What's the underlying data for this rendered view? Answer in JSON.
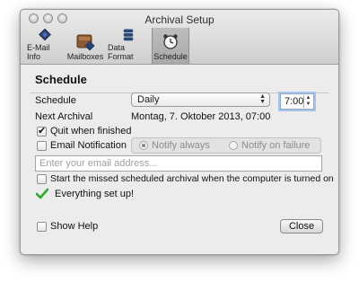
{
  "window": {
    "title": "Archival Setup"
  },
  "toolbar": {
    "items": [
      {
        "label": "E-Mail Info",
        "icon": "email-info-icon"
      },
      {
        "label": "Mailboxes",
        "icon": "mailboxes-icon"
      },
      {
        "label": "Data Format",
        "icon": "data-format-icon"
      },
      {
        "label": "Schedule",
        "icon": "alarm-clock-icon",
        "selected": true
      }
    ]
  },
  "section": {
    "heading": "Schedule"
  },
  "schedule": {
    "label": "Schedule",
    "selected": "Daily",
    "time": "7:00"
  },
  "next_archival": {
    "label": "Next Archival",
    "value": "Montag, 7. Oktober 2013, 07:00"
  },
  "quit_when_finished": {
    "label": "Quit when finished",
    "checked": true
  },
  "email_notification": {
    "label": "Email Notification",
    "checked": false,
    "options": [
      "Notify always",
      "Notify on failure"
    ],
    "selected": "Notify always",
    "placeholder": "Enter your email address..."
  },
  "missed_archival": {
    "label": "Start the missed scheduled archival when the computer is turned on",
    "checked": false
  },
  "status": {
    "text": "Everything set up!",
    "icon": "green-checkmark-icon",
    "color": "#2fa82f"
  },
  "show_help": {
    "label": "Show Help",
    "checked": false
  },
  "buttons": {
    "close": "Close"
  }
}
